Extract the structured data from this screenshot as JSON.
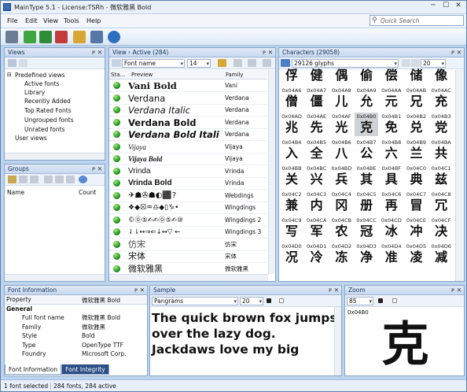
{
  "window": {
    "title": "MainType 5.1 - License:TSRh - 微软雅黑 Bold",
    "min": "─",
    "max": "☐",
    "close": "✕"
  },
  "menu": [
    "File",
    "Edit",
    "View",
    "Tools",
    "Help"
  ],
  "search": {
    "placeholder": "Quick Search",
    "icon": "⚲"
  },
  "views": {
    "title": "Views",
    "tree": [
      "Predefined views",
      "Active fonts",
      "Library",
      "Recently Added",
      "Top Rated Fonts",
      "Ungrouped fonts",
      "Unrated fonts",
      "User views"
    ]
  },
  "groups": {
    "title": "Groups",
    "col_name": "Name",
    "col_count": "Count"
  },
  "fontlist": {
    "title": "View › Active (284)",
    "sort_combo": "Font name",
    "size_combo": "14",
    "col_status": "Sta...",
    "col_preview": "Preview",
    "col_family": "Family",
    "rows": [
      {
        "preview": "Vani Bold",
        "family": "Vani"
      },
      {
        "preview": "Verdana",
        "family": "Verdana"
      },
      {
        "preview": "Verdana Italic",
        "family": "Verdana"
      },
      {
        "preview": "Verdana Bold",
        "family": "Verdana"
      },
      {
        "preview": "Verdana Bold Itali",
        "family": "Verdana"
      },
      {
        "preview": "Vijaya",
        "family": "Vijaya"
      },
      {
        "preview": "Vijaya Bold",
        "family": "Vijaya"
      },
      {
        "preview": "Vrinda",
        "family": "Vrinda"
      },
      {
        "preview": "Vrinda Bold",
        "family": "Vrinda"
      },
      {
        "preview": "✈☗✇☗◐⬛?",
        "family": "Webdings"
      },
      {
        "preview": "❖◆☒♒♎◆▯♑•",
        "family": "Wingdings"
      },
      {
        "preview": "©⓪⑤✍✍⓪⑤✍⑩",
        "family": "Wingdings 2"
      },
      {
        "preview": "⇃⇂↔⇒⇐↓↔▽ ←",
        "family": "Wingdings 3"
      },
      {
        "preview": "仿宋",
        "family": "仿宋"
      },
      {
        "preview": "宋体",
        "family": "宋体"
      },
      {
        "preview": "微软雅黑",
        "family": "微软雅黑"
      }
    ]
  },
  "characters": {
    "title": "Characters (29058)",
    "glyph_combo": "29126 glyphs",
    "size_combo": "20",
    "grid": [
      [
        [
          "",
          "俘"
        ],
        [
          "",
          "健"
        ],
        [
          "",
          "偶"
        ],
        [
          "",
          "偷"
        ],
        [
          "",
          "偿"
        ],
        [
          "",
          "储"
        ],
        [
          "",
          "像"
        ]
      ],
      [
        [
          "0x04A6",
          "僧"
        ],
        [
          "0x04A7",
          "僵"
        ],
        [
          "0x04A8",
          "儿"
        ],
        [
          "0x04A9",
          "允"
        ],
        [
          "0x04AA",
          "元"
        ],
        [
          "0x04AB",
          "兄"
        ],
        [
          "0x04AC",
          "充"
        ]
      ],
      [
        [
          "0x04AD",
          "兆"
        ],
        [
          "0x04AE",
          "先"
        ],
        [
          "0x04AF",
          "光"
        ],
        [
          "0x04B0",
          "克"
        ],
        [
          "0x04B1",
          "免"
        ],
        [
          "0x04B2",
          "兑"
        ],
        [
          "0x04B3",
          "党"
        ]
      ],
      [
        [
          "0x04B4",
          "入"
        ],
        [
          "0x04B5",
          "全"
        ],
        [
          "0x04B6",
          "八"
        ],
        [
          "0x04B7",
          "公"
        ],
        [
          "0x04B8",
          "六"
        ],
        [
          "0x04B9",
          "兰"
        ],
        [
          "0x04BA",
          "共"
        ]
      ],
      [
        [
          "0x04BB",
          "关"
        ],
        [
          "0x04BC",
          "兴"
        ],
        [
          "0x04BD",
          "兵"
        ],
        [
          "0x04BE",
          "其"
        ],
        [
          "0x04BF",
          "具"
        ],
        [
          "0x04C0",
          "典"
        ],
        [
          "0x04C1",
          "兹"
        ]
      ],
      [
        [
          "0x04C2",
          "兼"
        ],
        [
          "0x04C3",
          "内"
        ],
        [
          "0x04C4",
          "冈"
        ],
        [
          "0x04C5",
          "册"
        ],
        [
          "0x04C6",
          "再"
        ],
        [
          "0x04C7",
          "冒"
        ],
        [
          "0x04C8",
          "冗"
        ]
      ],
      [
        [
          "0x04C9",
          "写"
        ],
        [
          "0x04CA",
          "军"
        ],
        [
          "0x04CB",
          "农"
        ],
        [
          "0x04CC",
          "冠"
        ],
        [
          "0x04CD",
          "冰"
        ],
        [
          "0x04CE",
          "冲"
        ],
        [
          "0x04CF",
          "决"
        ]
      ],
      [
        [
          "0x04D0",
          "况"
        ],
        [
          "0x04D1",
          "冷"
        ],
        [
          "0x04D2",
          "冻"
        ],
        [
          "0x04D3",
          "净"
        ],
        [
          "0x04D4",
          "准"
        ],
        [
          "0x04D5",
          "凌"
        ],
        [
          "0x04D6",
          "减"
        ]
      ]
    ]
  },
  "fontinfo": {
    "title": "Font Information",
    "col_prop": "Property",
    "col_val": "微软雅黑 Bold",
    "group": "General",
    "rows": [
      [
        "Full font name",
        "微软雅黑 Bold"
      ],
      [
        "Family",
        "微软雅黑"
      ],
      [
        "Style",
        "Bold"
      ],
      [
        "Type",
        "OpenType TTF"
      ],
      [
        "Foundry",
        "Microsoft Corp."
      ]
    ],
    "tab1": "Font Information",
    "tab2": "Font Integrity"
  },
  "sample": {
    "title": "Sample",
    "combo": "Pangrams",
    "size": "20",
    "text": [
      "The quick brown fox jumps",
      "over the lazy dog.",
      "Jackdaws love my big"
    ]
  },
  "zoom": {
    "title": "Zoom",
    "size": "85",
    "code": "0x04B0",
    "glyph": "克"
  },
  "status": {
    "left": "1 font selected",
    "right": "284 fonts, 284 active"
  },
  "colors": {
    "frame": "#bcd4ee",
    "header": "#c8d9ef",
    "selected": "#cfd2d6"
  }
}
